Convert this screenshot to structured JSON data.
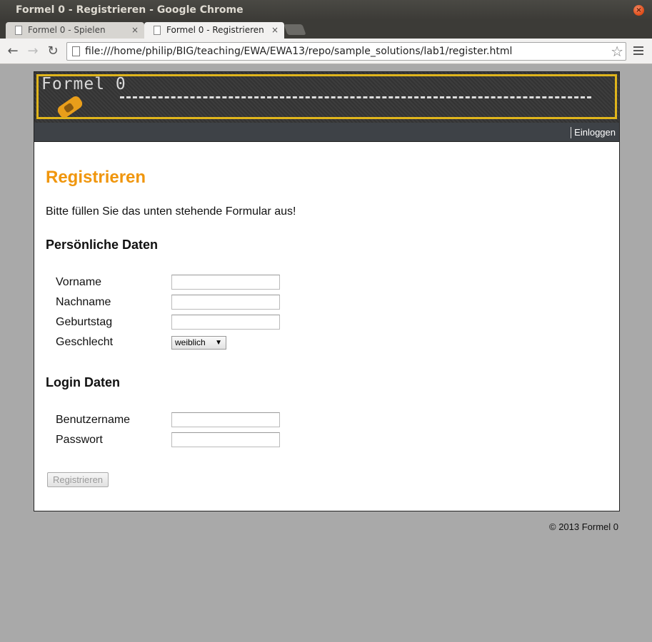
{
  "window": {
    "title": "Formel 0 - Registrieren - Google Chrome"
  },
  "tabs": [
    {
      "label": "Formel 0 - Spielen",
      "active": false
    },
    {
      "label": "Formel 0 - Registrieren",
      "active": true
    }
  ],
  "toolbar": {
    "url": "file:///home/philip/BIG/teaching/EWA/EWA13/repo/sample_solutions/lab1/register.html"
  },
  "banner": {
    "logo_text": "Formel 0"
  },
  "nav": {
    "login_label": "Einloggen"
  },
  "page": {
    "heading": "Registrieren",
    "intro": "Bitte füllen Sie das unten stehende Formular aus!",
    "personal_heading": "Persönliche Daten",
    "personal_fields": {
      "firstname_label": "Vorname",
      "lastname_label": "Nachname",
      "birthday_label": "Geburtstag",
      "gender_label": "Geschlecht",
      "gender_selected": "weiblich"
    },
    "login_heading": "Login Daten",
    "login_fields": {
      "username_label": "Benutzername",
      "password_label": "Passwort"
    },
    "submit_label": "Registrieren"
  },
  "footer": {
    "text": "© 2013 Formel 0"
  },
  "colors": {
    "accent": "#f0960d",
    "navbar": "#3e4247",
    "background": "#a9a9a9"
  }
}
